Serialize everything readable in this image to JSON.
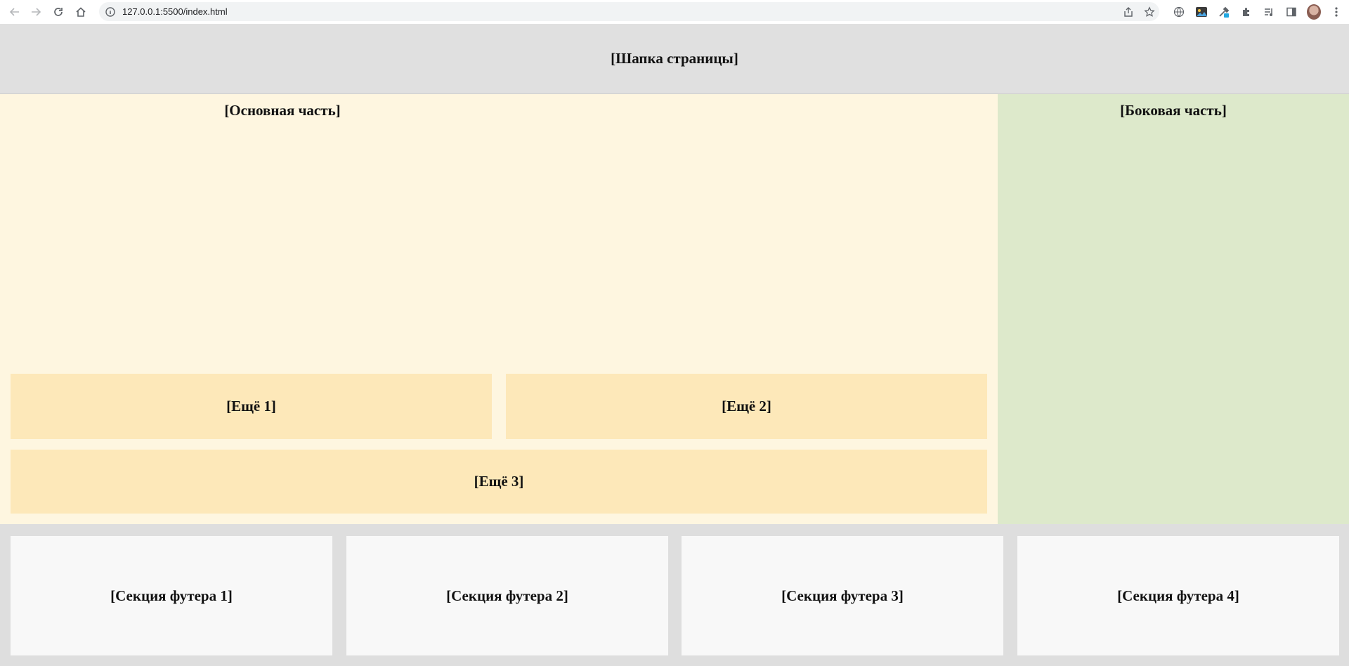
{
  "browser": {
    "url": "127.0.0.1:5500/index.html"
  },
  "page": {
    "header": "[Шапка страницы]",
    "main_title": "[Основная часть]",
    "more": [
      "[Ещё 1]",
      "[Ещё 2]",
      "[Ещё 3]"
    ],
    "aside_title": "[Боковая часть]",
    "footer_sections": [
      "[Секция футера 1]",
      "[Секция футера 2]",
      "[Секция футера 3]",
      "[Секция футера 4]"
    ]
  },
  "colors": {
    "header_bg": "#e0e0e0",
    "main_bg": "#fef6e0",
    "block_bg": "#fde8b9",
    "aside_bg": "#dde9cb",
    "footer_bg": "#dedede",
    "footer_section_bg": "#f8f8f8"
  },
  "icons": {
    "nav": [
      "back-arrow-icon",
      "forward-arrow-icon",
      "reload-icon",
      "home-icon"
    ],
    "omnibox": [
      "site-info-icon",
      "share-icon",
      "bookmark-star-icon"
    ],
    "toolbar": [
      "translate-icon",
      "extension-image-icon",
      "extension-eyedropper-icon",
      "extensions-puzzle-icon",
      "media-control-icon",
      "side-panel-icon",
      "profile-avatar",
      "menu-kebab-icon"
    ]
  }
}
